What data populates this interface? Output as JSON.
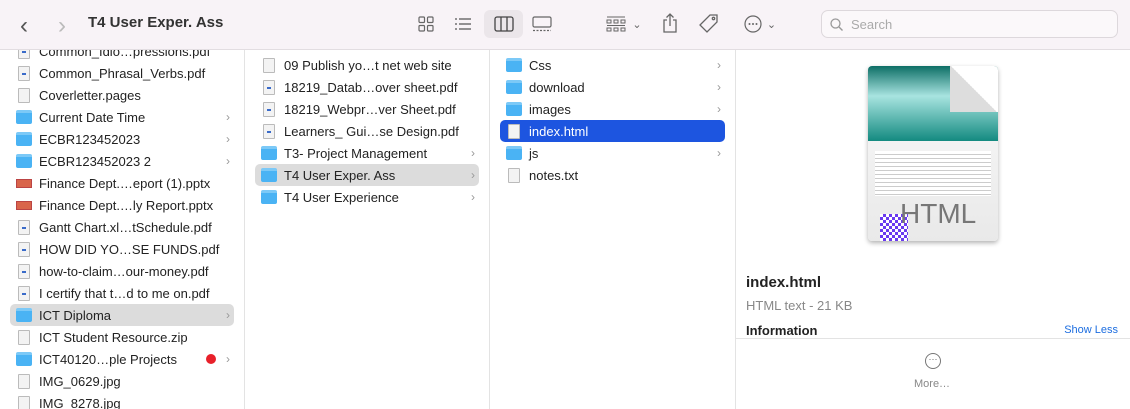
{
  "window": {
    "title": "T4 User Exper. Ass",
    "search_placeholder": "Search"
  },
  "toolbar": {
    "back": "‹",
    "forward": "›"
  },
  "columns": [
    {
      "items": [
        {
          "label": "Common_Idio…pressions.pdf",
          "type": "pdf"
        },
        {
          "label": "Common_Phrasal_Verbs.pdf",
          "type": "pdf"
        },
        {
          "label": "Coverletter.pages",
          "type": "doc"
        },
        {
          "label": "Current Date Time",
          "type": "folder"
        },
        {
          "label": "ECBR123452023",
          "type": "folder"
        },
        {
          "label": "ECBR123452023 2",
          "type": "folder"
        },
        {
          "label": "Finance Dept.…eport (1).pptx",
          "type": "ppt"
        },
        {
          "label": "Finance Dept.…ly Report.pptx",
          "type": "ppt"
        },
        {
          "label": "Gantt Chart.xl…tSchedule.pdf",
          "type": "pdf"
        },
        {
          "label": "HOW DID YO…SE FUNDS.pdf",
          "type": "pdf"
        },
        {
          "label": "how-to-claim…our-money.pdf",
          "type": "pdf"
        },
        {
          "label": "I certify that t…d to me on.pdf",
          "type": "pdf"
        },
        {
          "label": "ICT Diploma",
          "type": "folder",
          "state": "sel"
        },
        {
          "label": "ICT Student Resource.zip",
          "type": "doc"
        },
        {
          "label": "ICT40120…ple Projects",
          "type": "folder",
          "tag": "#e8202a"
        },
        {
          "label": "IMG_0629.jpg",
          "type": "doc"
        },
        {
          "label": "IMG_8278.jpg",
          "type": "doc"
        }
      ]
    },
    {
      "items": [
        {
          "label": "09 Publish yo…t net web site",
          "type": "doc"
        },
        {
          "label": "18219_Datab…over sheet.pdf",
          "type": "pdf"
        },
        {
          "label": "18219_Webpr…ver Sheet.pdf",
          "type": "pdf"
        },
        {
          "label": "Learners_ Gui…se Design.pdf",
          "type": "pdf"
        },
        {
          "label": "T3- Project Management",
          "type": "folder"
        },
        {
          "label": "T4 User Exper. Ass",
          "type": "folder",
          "state": "sel"
        },
        {
          "label": "T4 User Experience",
          "type": "folder"
        }
      ]
    },
    {
      "items": [
        {
          "label": "Css",
          "type": "folder"
        },
        {
          "label": "download",
          "type": "folder"
        },
        {
          "label": "images",
          "type": "folder"
        },
        {
          "label": "index.html",
          "type": "doc",
          "state": "act"
        },
        {
          "label": "js",
          "type": "folder"
        },
        {
          "label": "notes.txt",
          "type": "doc"
        }
      ]
    }
  ],
  "preview": {
    "thumb_label": "HTML",
    "name": "index.html",
    "kind_size": "HTML text - 21 KB",
    "info_heading": "Information",
    "show_less": "Show Less",
    "more": "More…"
  }
}
